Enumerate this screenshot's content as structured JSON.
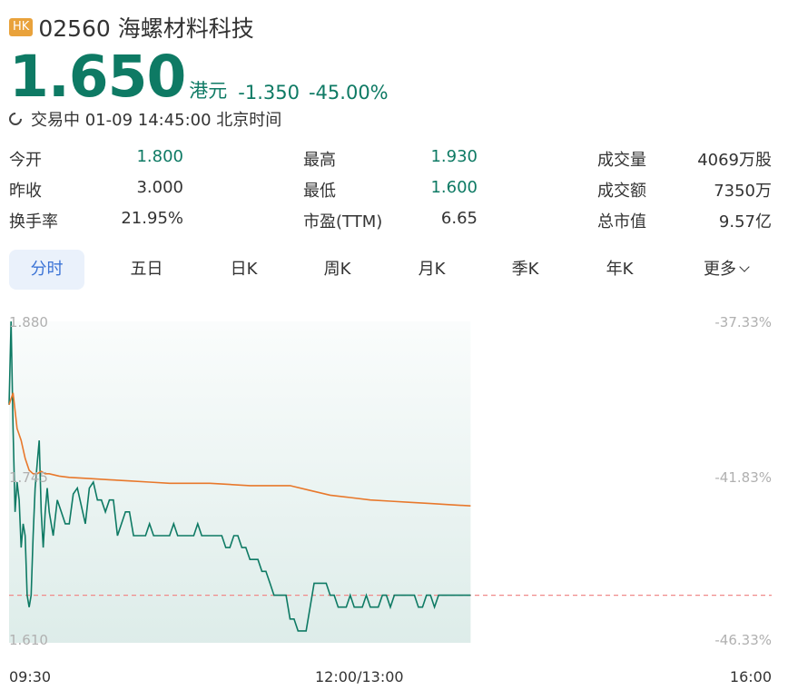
{
  "header": {
    "market_badge": "HK",
    "title": "02560 海螺材料科技"
  },
  "quote": {
    "price": "1.650",
    "unit": "港元",
    "change": "-1.350",
    "change_pct": "-45.00%"
  },
  "status": {
    "text": "交易中 01-09 14:45:00 北京时间"
  },
  "stats": [
    {
      "label": "今开",
      "value": "1.800",
      "color": "green"
    },
    {
      "label": "最高",
      "value": "1.930",
      "color": "green"
    },
    {
      "label": "成交量",
      "value": "4069万股",
      "color": "dark"
    },
    {
      "label": "昨收",
      "value": "3.000",
      "color": "dark"
    },
    {
      "label": "最低",
      "value": "1.600",
      "color": "green"
    },
    {
      "label": "成交额",
      "value": "7350万",
      "color": "dark"
    },
    {
      "label": "换手率",
      "value": "21.95%",
      "color": "dark"
    },
    {
      "label": "市盈(TTM)",
      "value": "6.65",
      "color": "dark"
    },
    {
      "label": "总市值",
      "value": "9.57亿",
      "color": "dark"
    }
  ],
  "tabs": [
    "分时",
    "五日",
    "日K",
    "周K",
    "月K",
    "季K",
    "年K",
    "更多"
  ],
  "active_tab": "分时",
  "colors": {
    "up_down_green": "#0e7a64",
    "avg_line": "#e8782b",
    "ref_line": "#f08a8a",
    "tab_active": "#3c74d6"
  },
  "chart_data": {
    "type": "line",
    "y_left_ticks": [
      "1.880",
      "1.745",
      "1.610"
    ],
    "y_right_ticks": [
      "-37.33%",
      "-41.83%",
      "-46.33%"
    ],
    "x_ticks": [
      "09:30",
      "12:00/13:00",
      "16:00"
    ],
    "ylim": [
      1.61,
      1.88
    ],
    "reference_value": 1.65,
    "series": [
      {
        "role": "price",
        "x": [
          0,
          1,
          2,
          3,
          4,
          5,
          6,
          7,
          8,
          9,
          10,
          11,
          12,
          13,
          14,
          15,
          16,
          17,
          18,
          19,
          20,
          22,
          24,
          26,
          28,
          30,
          32,
          34,
          36,
          38,
          40,
          42,
          44,
          46,
          48,
          50,
          52,
          54,
          56,
          58,
          60,
          62,
          64,
          66,
          68,
          70,
          72,
          74,
          76,
          78,
          80,
          82,
          84,
          86,
          88,
          90,
          92,
          94,
          96,
          98,
          100,
          102,
          104,
          106,
          108,
          110,
          112,
          114,
          116,
          118,
          120,
          122,
          124,
          126,
          128,
          130,
          132,
          134,
          136,
          138,
          140,
          142,
          144,
          146,
          148,
          150,
          152,
          154,
          156,
          158,
          160,
          162,
          164,
          166,
          168,
          170,
          172,
          174,
          176,
          178,
          180,
          182,
          184,
          186,
          188,
          190,
          192,
          194,
          196,
          198,
          200,
          202,
          204,
          206,
          208,
          210,
          212,
          214,
          216,
          218,
          220,
          222,
          224,
          226,
          228,
          230
        ],
        "y": [
          1.81,
          1.88,
          1.79,
          1.72,
          1.745,
          1.73,
          1.69,
          1.71,
          1.7,
          1.65,
          1.64,
          1.65,
          1.7,
          1.74,
          1.76,
          1.78,
          1.72,
          1.69,
          1.72,
          1.74,
          1.72,
          1.7,
          1.73,
          1.72,
          1.71,
          1.71,
          1.735,
          1.74,
          1.725,
          1.71,
          1.74,
          1.745,
          1.73,
          1.73,
          1.72,
          1.73,
          1.73,
          1.7,
          1.71,
          1.72,
          1.72,
          1.7,
          1.7,
          1.7,
          1.7,
          1.71,
          1.7,
          1.7,
          1.7,
          1.7,
          1.7,
          1.71,
          1.7,
          1.7,
          1.7,
          1.7,
          1.7,
          1.71,
          1.7,
          1.7,
          1.7,
          1.7,
          1.7,
          1.7,
          1.69,
          1.69,
          1.7,
          1.7,
          1.69,
          1.69,
          1.68,
          1.68,
          1.68,
          1.67,
          1.67,
          1.66,
          1.65,
          1.65,
          1.65,
          1.65,
          1.63,
          1.63,
          1.62,
          1.62,
          1.62,
          1.64,
          1.66,
          1.66,
          1.66,
          1.66,
          1.65,
          1.65,
          1.64,
          1.64,
          1.64,
          1.65,
          1.64,
          1.64,
          1.64,
          1.65,
          1.64,
          1.64,
          1.64,
          1.65,
          1.65,
          1.64,
          1.65,
          1.65,
          1.65,
          1.65,
          1.65,
          1.65,
          1.64,
          1.64,
          1.65,
          1.65,
          1.64,
          1.65,
          1.65,
          1.65,
          1.65,
          1.65,
          1.65,
          1.65,
          1.65,
          1.65
        ]
      },
      {
        "role": "average",
        "x": [
          0,
          2,
          4,
          6,
          8,
          10,
          12,
          14,
          16,
          18,
          20,
          25,
          30,
          40,
          50,
          60,
          70,
          80,
          90,
          100,
          110,
          120,
          140,
          150,
          160,
          170,
          180,
          190,
          200,
          210,
          220,
          230
        ],
        "y": [
          1.81,
          1.82,
          1.79,
          1.78,
          1.765,
          1.755,
          1.752,
          1.752,
          1.754,
          1.752,
          1.752,
          1.75,
          1.749,
          1.748,
          1.747,
          1.746,
          1.745,
          1.744,
          1.744,
          1.744,
          1.743,
          1.742,
          1.742,
          1.738,
          1.734,
          1.732,
          1.73,
          1.729,
          1.728,
          1.727,
          1.726,
          1.725
        ]
      }
    ]
  }
}
